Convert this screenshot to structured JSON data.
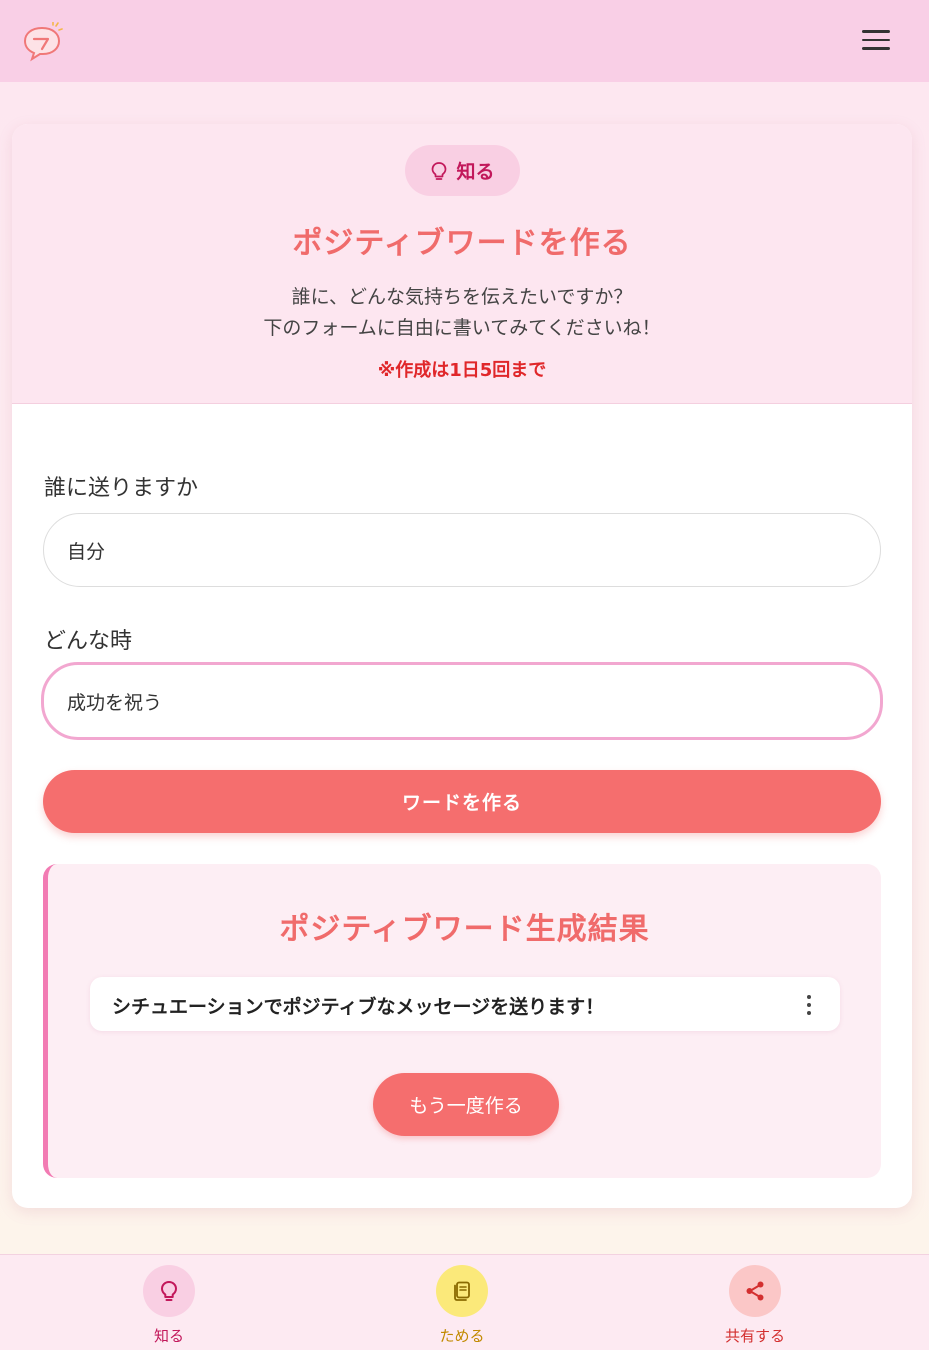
{
  "header": {
    "logo_icon": "speech-bubble-logo-icon",
    "menu_icon": "hamburger-menu-icon"
  },
  "intro": {
    "badge_label": "知る",
    "badge_icon": "lightbulb-icon",
    "title": "ポジティブワードを作る",
    "subtitle_line1": "誰に、どんな気持ちを伝えたいですか？",
    "subtitle_line2": "下のフォームに自由に書いてみてくださいね！",
    "note": "※作成は1日5回まで"
  },
  "form": {
    "recipient_label": "誰に送りますか",
    "recipient_value": "自分",
    "occasion_label": "どんな時",
    "occasion_value": "成功を祝う",
    "submit_label": "ワードを作る"
  },
  "result": {
    "title": "ポジティブワード生成結果",
    "items": [
      "シチュエーションでポジティブなメッセージを送ります！"
    ],
    "item_menu_icon": "more-vertical-icon",
    "retry_label": "もう一度作る"
  },
  "bottom_nav": {
    "items": [
      {
        "label": "知る",
        "icon": "lightbulb-icon",
        "bg": "#f9cfe3",
        "color": "#c2185b"
      },
      {
        "label": "ためる",
        "icon": "notebook-icon",
        "bg": "#fbe97a",
        "color": "#c28a00"
      },
      {
        "label": "共有する",
        "icon": "share-icon",
        "bg": "#fbc7c7",
        "color": "#d32f2f"
      }
    ]
  },
  "colors": {
    "accent": "#f56e6e",
    "pink": "#f27bb3",
    "header_bg": "#f9cfe6"
  }
}
